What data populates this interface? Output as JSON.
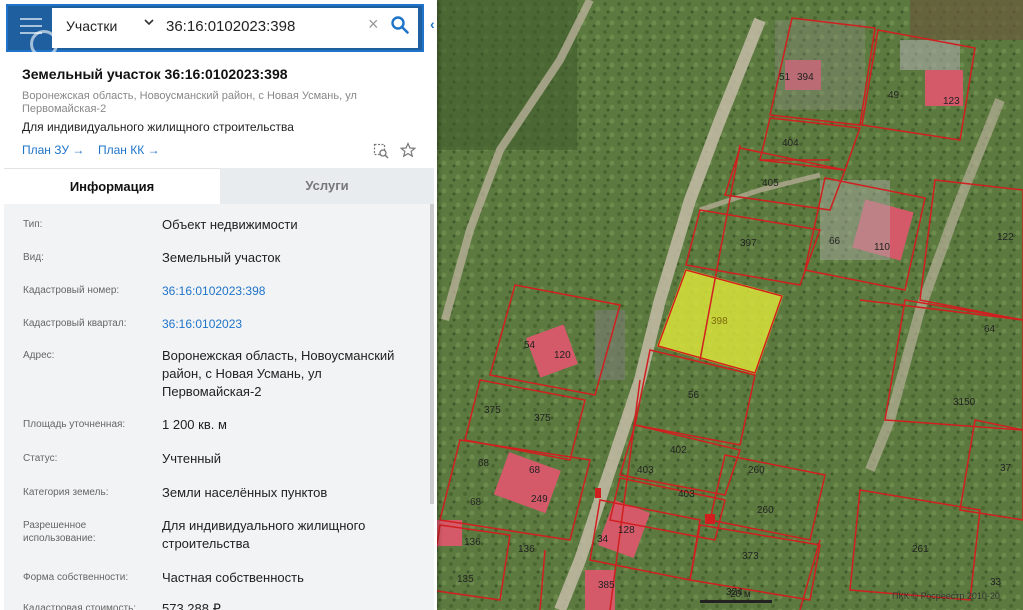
{
  "search": {
    "layer": "Участки",
    "value": "36:16:0102023:398"
  },
  "object": {
    "title": "Земельный участок 36:16:0102023:398",
    "address_short": "Воронежская область, Новоусманский район, с Новая Усмань, ул Первомайская-2",
    "purpose": "Для индивидуального жилищного строительства",
    "link_zu": "План ЗУ →",
    "link_kk": "План КК →"
  },
  "tabs": {
    "info": "Информация",
    "services": "Услуги"
  },
  "rows": [
    {
      "label": "Тип:",
      "value": "Объект недвижимости"
    },
    {
      "label": "Вид:",
      "value": "Земельный участок"
    },
    {
      "label": "Кадастровый номер:",
      "value": "36:16:0102023:398"
    },
    {
      "label": "Кадастровый квартал:",
      "value": "36:16:0102023"
    },
    {
      "label": "Адрес:",
      "value": "Воронежская область, Новоусманский район, с Новая Усмань, ул Первомайская-2"
    },
    {
      "label": "Площадь уточненная:",
      "value": "1 200 кв. м"
    },
    {
      "label": "Статус:",
      "value": "Учтенный"
    },
    {
      "label": "Категория земель:",
      "value": "Земли населённых пунктов"
    },
    {
      "label": "Разрешенное использование:",
      "value": "Для индивидуального жилищного строительства"
    },
    {
      "label": "Форма собственности:",
      "value": "Частная собственность"
    },
    {
      "label": "Кадастровая стоимость:",
      "value": "573 288 ₽"
    }
  ],
  "map": {
    "selected_lot": "398",
    "lots": [
      "51",
      "394",
      "49",
      "123",
      "404",
      "405",
      "66",
      "110",
      "122",
      "397",
      "398",
      "54",
      "120",
      "56",
      "64",
      "375",
      "375",
      "3150",
      "402",
      "260",
      "68",
      "68",
      "249",
      "68",
      "403",
      "403",
      "260",
      "37",
      "34",
      "128",
      "136",
      "136",
      "373",
      "261",
      "135",
      "385",
      "324",
      "33"
    ],
    "scale": "20 м",
    "copyright": "ПКК © Росреестр 2010-20"
  },
  "colors": {
    "accent": "#1f74c9",
    "selected_fill": "#d8e23a",
    "boundary": "#d11f1f"
  }
}
